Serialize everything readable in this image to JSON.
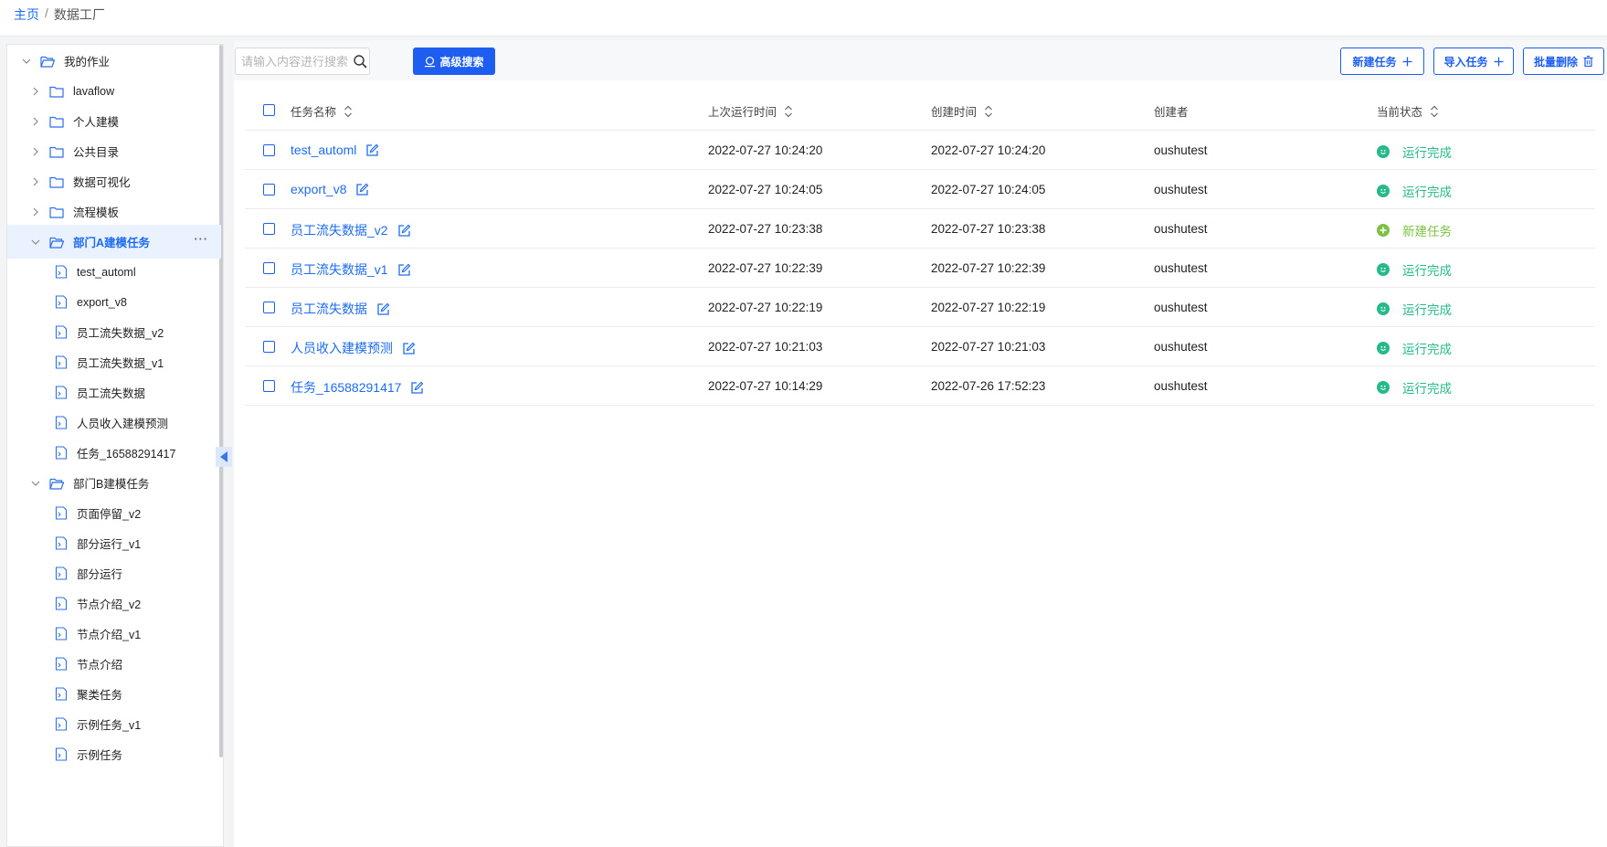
{
  "breadcrumb": {
    "home": "主页",
    "separator": "/",
    "current": "数据工厂"
  },
  "sidebar": {
    "root": "我的作业",
    "folders": [
      "lavaflow",
      "个人建模",
      "公共目录",
      "数据可视化",
      "流程模板"
    ],
    "group_a": {
      "label": "部门A建模任务",
      "more": "···",
      "items": [
        "test_automl",
        "export_v8",
        "员工流失数据_v2",
        "员工流失数据_v1",
        "员工流失数据",
        "人员收入建模预测",
        "任务_16588291417"
      ]
    },
    "group_b": {
      "label": "部门B建模任务",
      "items": [
        "页面停留_v2",
        "部分运行_v1",
        "部分运行",
        "节点介绍_v2",
        "节点介绍_v1",
        "节点介绍",
        "聚类任务",
        "示例任务_v1",
        "示例任务"
      ]
    }
  },
  "toolbar": {
    "search_placeholder": "请输入内容进行搜索",
    "advanced_search": "高级搜索",
    "new_task": "新建任务",
    "import_task": "导入任务",
    "batch_delete": "批量删除"
  },
  "table": {
    "headers": {
      "name": "任务名称",
      "last_run": "上次运行时间",
      "created": "创建时间",
      "creator": "创建者",
      "status": "当前状态"
    },
    "rows": [
      {
        "name": "test_automl",
        "last_run": "2022-07-27 10:24:20",
        "created": "2022-07-27 10:24:20",
        "creator": "oushutest",
        "status": "运行完成",
        "status_type": "done"
      },
      {
        "name": "export_v8",
        "last_run": "2022-07-27 10:24:05",
        "created": "2022-07-27 10:24:05",
        "creator": "oushutest",
        "status": "运行完成",
        "status_type": "done"
      },
      {
        "name": "员工流失数据_v2",
        "last_run": "2022-07-27 10:23:38",
        "created": "2022-07-27 10:23:38",
        "creator": "oushutest",
        "status": "新建任务",
        "status_type": "new"
      },
      {
        "name": "员工流失数据_v1",
        "last_run": "2022-07-27 10:22:39",
        "created": "2022-07-27 10:22:39",
        "creator": "oushutest",
        "status": "运行完成",
        "status_type": "done"
      },
      {
        "name": "员工流失数据",
        "last_run": "2022-07-27 10:22:19",
        "created": "2022-07-27 10:22:19",
        "creator": "oushutest",
        "status": "运行完成",
        "status_type": "done"
      },
      {
        "name": "人员收入建模预测",
        "last_run": "2022-07-27 10:21:03",
        "created": "2022-07-27 10:21:03",
        "creator": "oushutest",
        "status": "运行完成",
        "status_type": "done"
      },
      {
        "name": "任务_16588291417",
        "last_run": "2022-07-27 10:14:29",
        "created": "2022-07-26 17:52:23",
        "creator": "oushutest",
        "status": "运行完成",
        "status_type": "done"
      }
    ]
  },
  "colors": {
    "primary": "#1d5ef0",
    "link": "#1d6cf0",
    "done": "#26b98a",
    "new": "#7cc242"
  }
}
